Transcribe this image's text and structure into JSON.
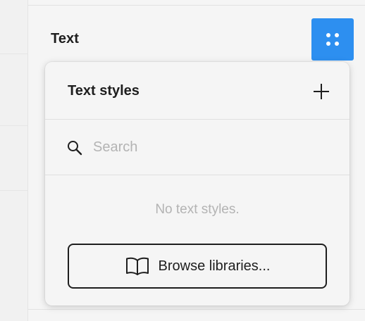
{
  "panel": {
    "section_title": "Text",
    "styles_button_icon": "four-dots-icon",
    "accent_color": "#2d8ff0"
  },
  "popover": {
    "title": "Text styles",
    "add_icon": "plus-icon",
    "search": {
      "icon": "search-icon",
      "placeholder": "Search",
      "value": ""
    },
    "empty_message": "No text styles.",
    "browse_button": {
      "icon": "book-icon",
      "label": "Browse libraries..."
    }
  }
}
